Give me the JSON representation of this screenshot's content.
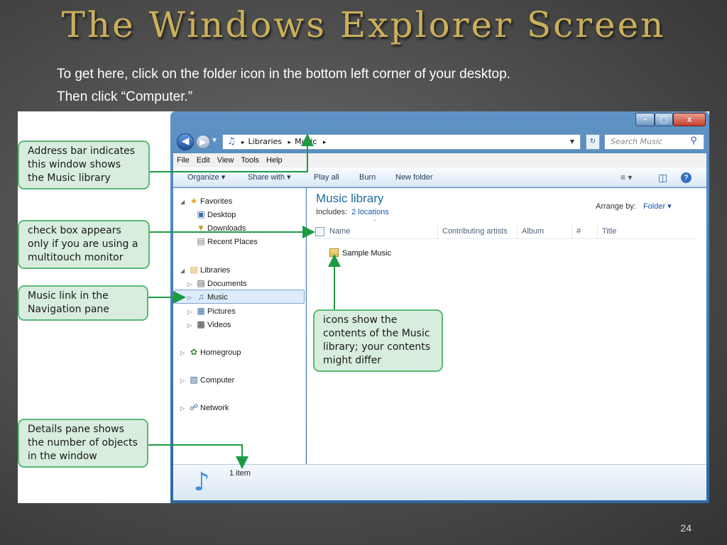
{
  "slide": {
    "title": "The Windows Explorer Screen",
    "intro_line1": "To get here, click on the folder icon in the bottom left corner of your desktop.",
    "intro_line2": "Then click “Computer.”",
    "page_number": "24"
  },
  "callouts": {
    "address_bar": "Address bar indicates this window shows the Music library",
    "check_box": "check box appears only if you are using a multitouch monitor",
    "music_link": "Music link in the Navigation pane",
    "icons": "icons show the contents of the Music library; your contents might differ",
    "details_pane": "Details pane shows the number of objects in the window"
  },
  "window": {
    "minimize": "–",
    "maximize": "□",
    "close": "x"
  },
  "address": {
    "part1": "Libraries",
    "part2": "Music",
    "sep": "▸"
  },
  "search": {
    "placeholder": "Search Music"
  },
  "menu": [
    "File",
    "Edit",
    "View",
    "Tools",
    "Help"
  ],
  "toolbar": {
    "organize": "Organize ▾",
    "share_with": "Share with ▾",
    "play_all": "Play all",
    "burn": "Burn",
    "new_folder": "New folder"
  },
  "nav": {
    "favorites": "Favorites",
    "desktop": "Desktop",
    "downloads": "Downloads",
    "recent_places": "Recent Places",
    "libraries": "Libraries",
    "documents": "Documents",
    "music": "Music",
    "pictures": "Pictures",
    "videos": "Videos",
    "homegroup": "Homegroup",
    "computer": "Computer",
    "network": "Network"
  },
  "library": {
    "title": "Music library",
    "includes_label": "Includes:",
    "includes_link": "2 locations",
    "arrange_label": "Arrange by:",
    "arrange_value": "Folder ▾"
  },
  "columns": [
    "Name",
    "Contributing artists",
    "Album",
    "#",
    "Title"
  ],
  "files": [
    {
      "name": "Sample Music"
    }
  ],
  "details": {
    "count": "1 item"
  },
  "colors": {
    "callout_fill": "#d8eddd",
    "callout_border": "#5bb877",
    "arrow": "#1e9a45",
    "title_gold": "#cbb05a"
  }
}
